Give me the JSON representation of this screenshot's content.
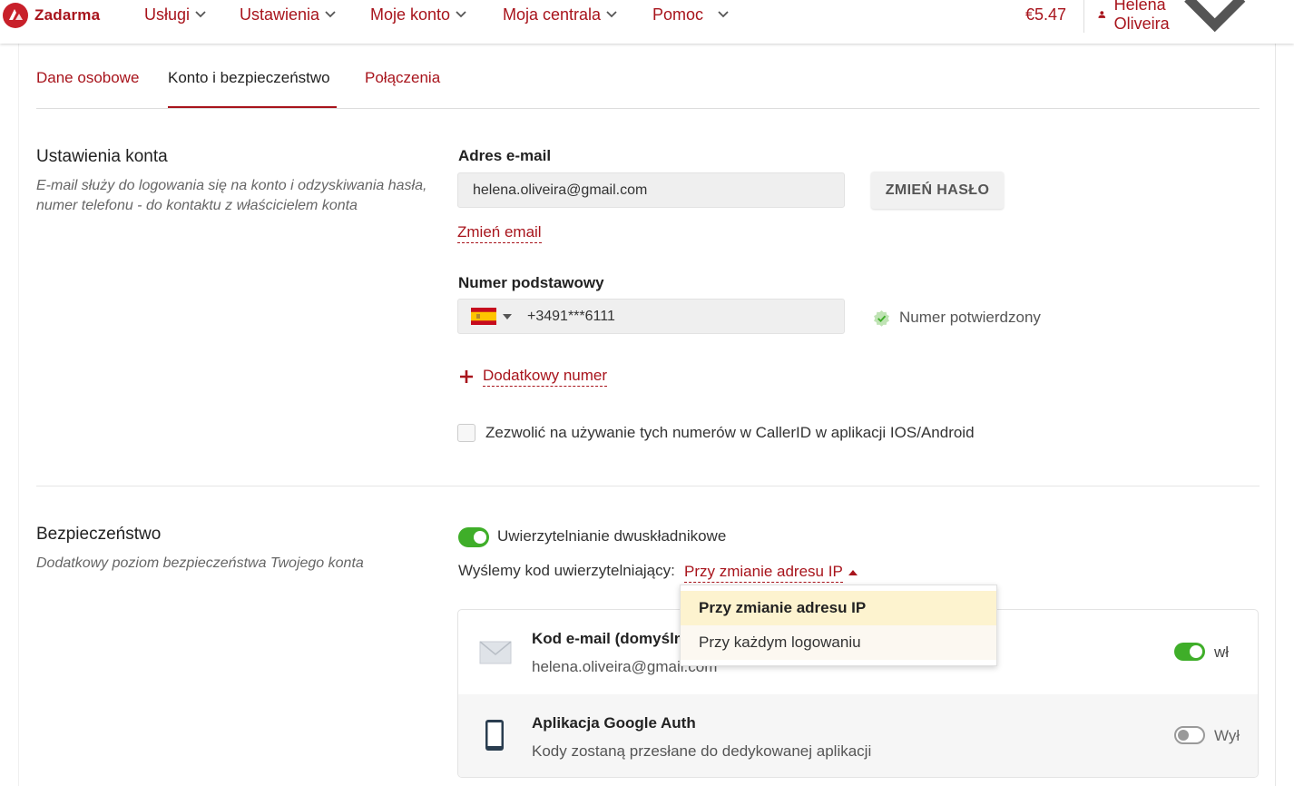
{
  "header": {
    "brand": "Zadarma",
    "nav": [
      {
        "label": "Usługi"
      },
      {
        "label": "Ustawienia"
      },
      {
        "label": "Moje konto"
      },
      {
        "label": "Moja centrala"
      },
      {
        "label": "Pomoc"
      }
    ],
    "balance": "€5.47",
    "user_name": "Helena Oliveira"
  },
  "tabs": [
    {
      "label": "Dane osobowe",
      "active": false
    },
    {
      "label": "Konto i bezpieczeństwo",
      "active": true
    },
    {
      "label": "Połączenia",
      "active": false
    }
  ],
  "account": {
    "title": "Ustawienia konta",
    "description": "E-mail służy do logowania się na konto i odzyskiwania hasła, numer telefonu - do kontaktu z właścicielem konta",
    "email_label": "Adres e-mail",
    "email_value": "helena.oliveira@gmail.com",
    "change_password": "ZMIEŃ HASŁO",
    "change_email": "Zmień email",
    "phone_label": "Numer podstawowy",
    "phone_value": "+3491***6111",
    "phone_status": "Numer potwierdzony",
    "add_number": "Dodatkowy numer",
    "callerid_label": "Zezwolić na używanie tych numerów w CallerID w aplikacji IOS/Android"
  },
  "security": {
    "title": "Bezpieczeństwo",
    "description": "Dodatkowy poziom bezpieczeństwa Twojego konta",
    "twofa_label": "Uwierzytelnianie dwuskładnikowe",
    "send_code_label": "Wyślemy kod uwierzytelniający:",
    "send_code_value": "Przy zmianie adresu IP",
    "dropdown_options": [
      "Przy zmianie adresu IP",
      "Przy każdym logowaniu"
    ],
    "methods": [
      {
        "title": "Kod e-mail (domyślnie)",
        "subtitle": "helena.oliveira@gmail.com",
        "state": "wł"
      },
      {
        "title": "Aplikacja Google Auth",
        "subtitle": "Kody zostaną przesłane do dedykowanej aplikacji",
        "state": "Wył"
      }
    ]
  },
  "colors": {
    "accent": "#a8141c",
    "toggle_on": "#3fae29"
  }
}
